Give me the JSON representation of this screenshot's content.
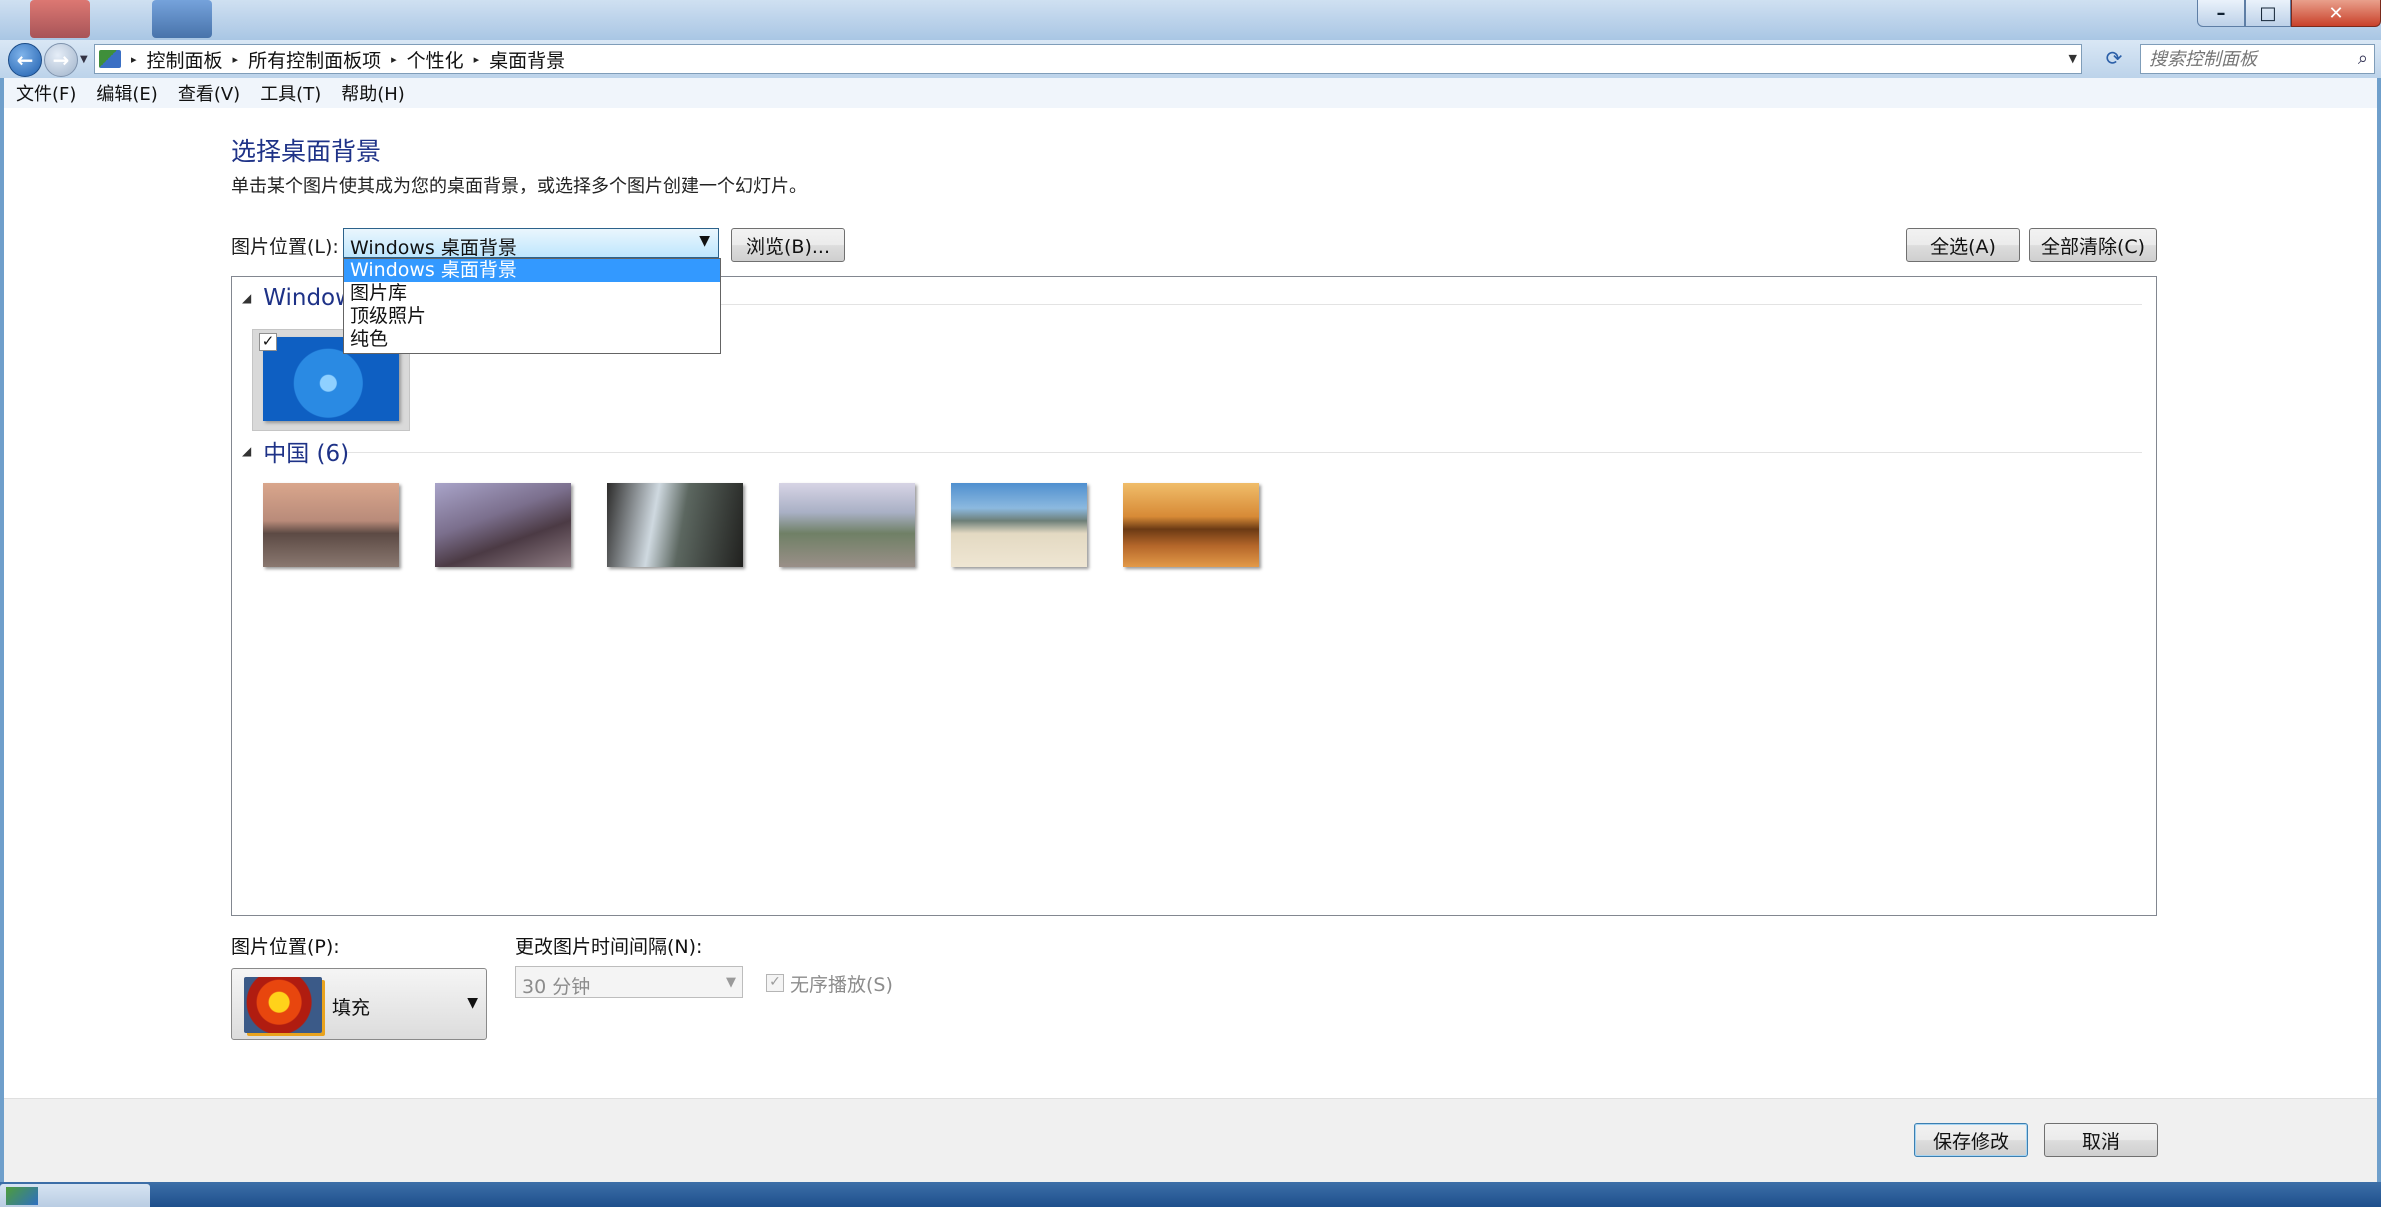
{
  "window": {
    "caption": {
      "minimize": "–",
      "maximize": "□",
      "close": "✕"
    }
  },
  "nav": {
    "back_icon": "arrow-left-icon",
    "forward_icon": "arrow-right-icon",
    "dropdown_glyph": "▼"
  },
  "address": {
    "breadcrumbs": [
      "控制面板",
      "所有控制面板项",
      "个性化",
      "桌面背景"
    ],
    "separator": "▸",
    "dropdown_glyph": "▼",
    "refresh_glyph": "⟳"
  },
  "search": {
    "placeholder": "搜索控制面板",
    "icon": "search-icon",
    "glyph": "⌕"
  },
  "menu": [
    "文件(F)",
    "编辑(E)",
    "查看(V)",
    "工具(T)",
    "帮助(H)"
  ],
  "page": {
    "title": "选择桌面背景",
    "description": "单击某个图片使其成为您的桌面背景，或选择多个图片创建一个幻灯片。"
  },
  "location": {
    "label": "图片位置(L):",
    "selected": "Windows 桌面背景",
    "arrow": "▼",
    "options": [
      "Windows 桌面背景",
      "图片库",
      "顶级照片",
      "纯色"
    ],
    "browse_button": "浏览(B)..."
  },
  "actions": {
    "select_all": "全选(A)",
    "clear_all": "全部清除(C)"
  },
  "gallery": {
    "groups": [
      {
        "title": "Windows",
        "thumbnails": [
          {
            "name": "windows-7-logo",
            "checked": true,
            "colors": [
              "#1c6fd6",
              "#5fb2ff"
            ]
          }
        ]
      },
      {
        "title": "中国 (6)",
        "thumbnails": [
          {
            "name": "li-river-karst",
            "colors": [
              "#c9a38c",
              "#6a4a3e"
            ]
          },
          {
            "name": "great-wall",
            "colors": [
              "#8e8fb8",
              "#5b4a5e"
            ]
          },
          {
            "name": "huangshan-peaks",
            "colors": [
              "#9fb7c6",
              "#2f3430"
            ]
          },
          {
            "name": "rice-terraces",
            "colors": [
              "#c8c9d8",
              "#586b55"
            ]
          },
          {
            "name": "beach-rocks",
            "colors": [
              "#5f9bd6",
              "#e8dfc8"
            ]
          },
          {
            "name": "seventeen-arch-bridge",
            "colors": [
              "#e9a84e",
              "#6e3b12"
            ]
          }
        ]
      }
    ],
    "collapse_glyph": "◢",
    "check_glyph": "✓"
  },
  "position": {
    "label": "图片位置(P):",
    "value": "填充",
    "arrow": "▼",
    "icon": "flower-fill-icon"
  },
  "interval": {
    "label": "更改图片时间间隔(N):",
    "value": "30 分钟",
    "arrow": "▼"
  },
  "shuffle": {
    "label": "无序播放(S)",
    "checked": true,
    "glyph": "✓"
  },
  "footer": {
    "save": "保存修改",
    "cancel": "取消"
  }
}
